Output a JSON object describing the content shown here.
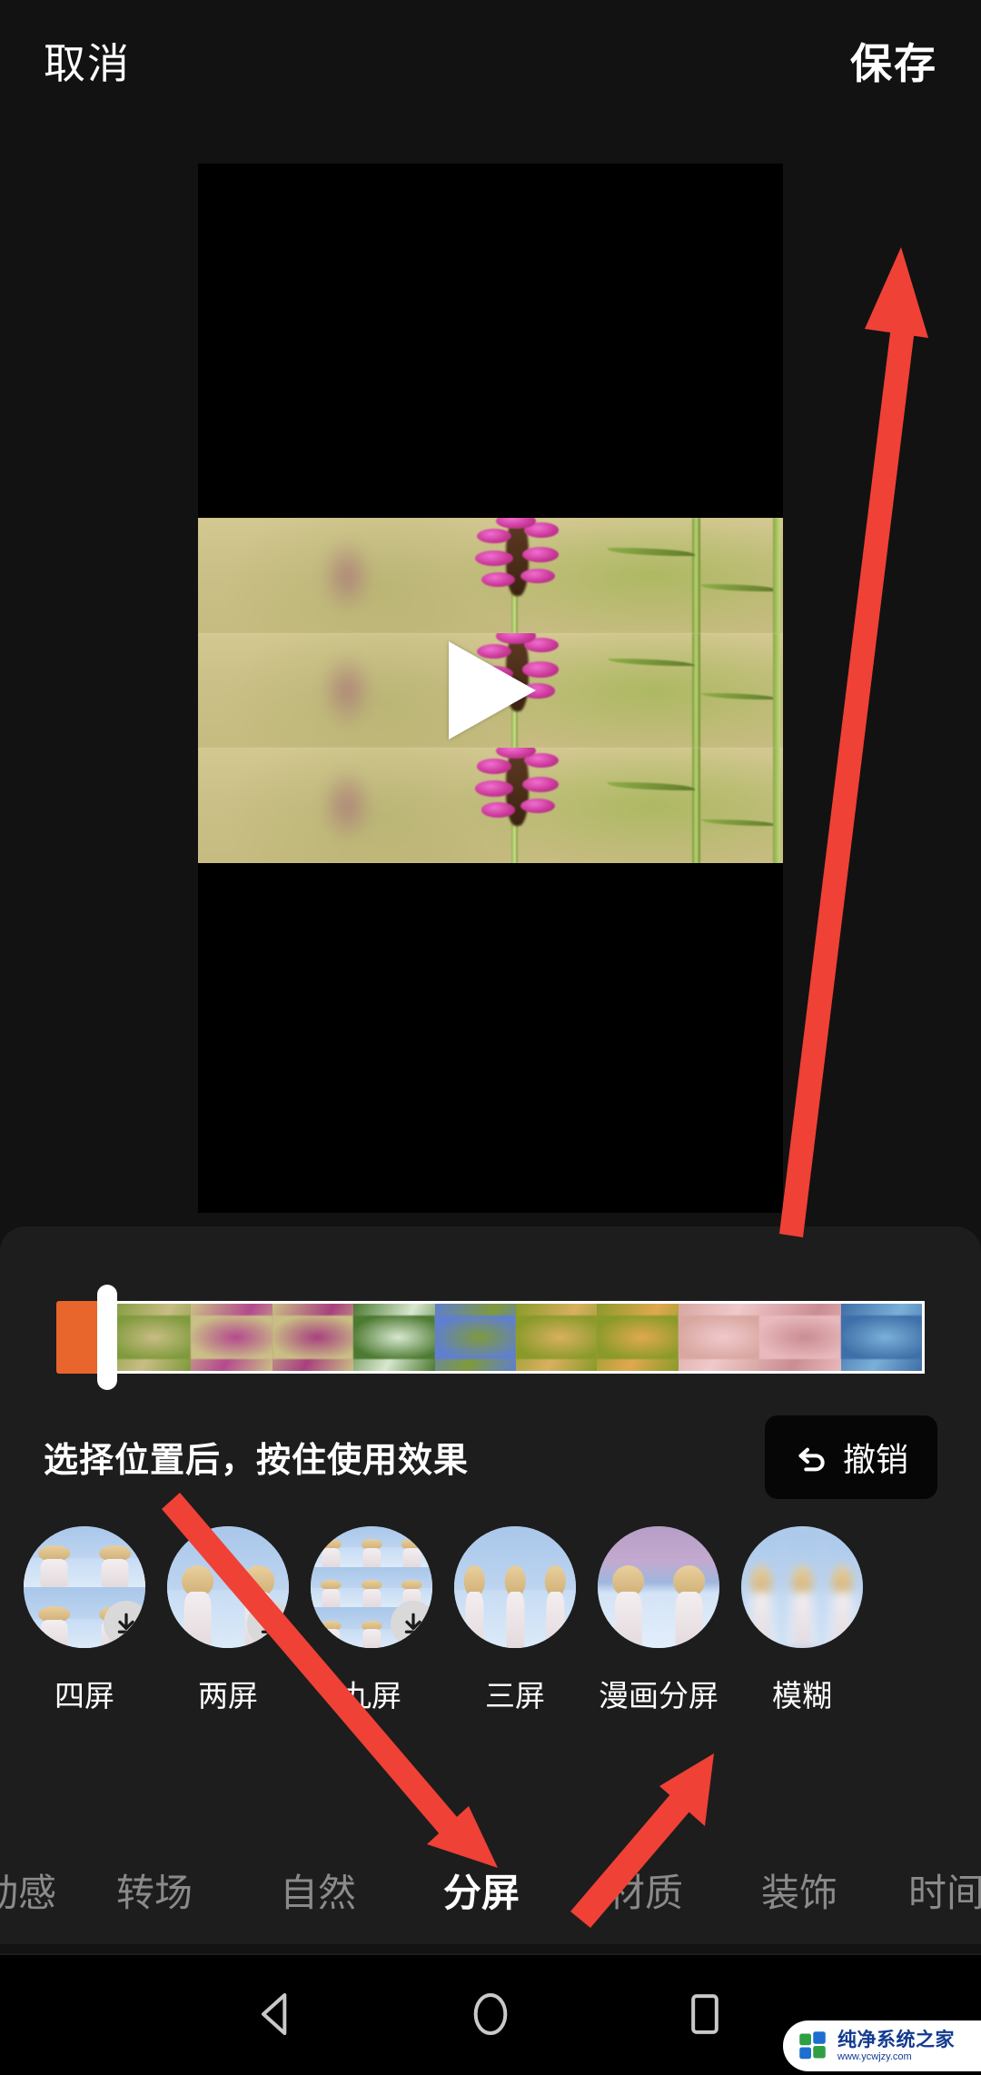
{
  "app": {
    "screen_name": "video-effects-editor",
    "accent_orange": "#e8652c",
    "annotation_red": "#ef4136",
    "panel_bg": "#1d1d1d",
    "screen_bg": "#121212"
  },
  "topbar": {
    "cancel_label": "取消",
    "save_label": "保存"
  },
  "preview": {
    "play_icon": "play-triangle-icon",
    "effect_applied": "三屏",
    "split_panes": 3
  },
  "timeline": {
    "clip_marker_color": "#e8652c",
    "playhead_position_pct": 4,
    "frames": [
      {
        "name": "frame-1",
        "colors": [
          "#7f9a3c",
          "#c8bd84"
        ]
      },
      {
        "name": "frame-2",
        "colors": [
          "#cabf86",
          "#b4498f"
        ]
      },
      {
        "name": "frame-3",
        "colors": [
          "#c9be84",
          "#a8407f"
        ]
      },
      {
        "name": "frame-4",
        "colors": [
          "#4d7a32",
          "#d8e8d0"
        ]
      },
      {
        "name": "frame-5",
        "colors": [
          "#5f7fd0",
          "#7f9a3c"
        ]
      },
      {
        "name": "frame-6",
        "colors": [
          "#8a9a2a",
          "#d8b060"
        ]
      },
      {
        "name": "frame-7",
        "colors": [
          "#8a9a2a",
          "#e0a94e"
        ]
      },
      {
        "name": "frame-8",
        "colors": [
          "#d8a7a0",
          "#f0c9cc"
        ]
      },
      {
        "name": "frame-9",
        "colors": [
          "#e8b9bd",
          "#c98d92"
        ]
      },
      {
        "name": "frame-10",
        "colors": [
          "#3f6fa8",
          "#7ab0d8"
        ]
      }
    ]
  },
  "hint": {
    "text": "选择位置后，按住使用效果"
  },
  "undo": {
    "label": "撤销",
    "icon": "undo-arrow-icon"
  },
  "effects": {
    "items": [
      {
        "name": "four-screen",
        "label": "四屏",
        "grid": "2x2",
        "needs_download": true,
        "style": "person"
      },
      {
        "name": "two-screen",
        "label": "两屏",
        "grid": "1x2",
        "needs_download": true,
        "style": "person"
      },
      {
        "name": "nine-screen",
        "label": "九屏",
        "grid": "3x3",
        "needs_download": true,
        "style": "person"
      },
      {
        "name": "three-screen",
        "label": "三屏",
        "grid": "1x3",
        "needs_download": false,
        "style": "person"
      },
      {
        "name": "comic-split",
        "label": "漫画分屏",
        "grid": "1x2",
        "needs_download": false,
        "style": "comic"
      },
      {
        "name": "blur",
        "label": "模糊",
        "grid": "1x3",
        "needs_download": false,
        "style": "blur"
      }
    ]
  },
  "tabs": {
    "items": [
      {
        "name": "tab-dynamic",
        "label": "动感",
        "active": false
      },
      {
        "name": "tab-transition",
        "label": "转场",
        "active": false
      },
      {
        "name": "tab-natural",
        "label": "自然",
        "active": false
      },
      {
        "name": "tab-split-screen",
        "label": "分屏",
        "active": true
      },
      {
        "name": "tab-material",
        "label": "材质",
        "active": false
      },
      {
        "name": "tab-decoration",
        "label": "装饰",
        "active": false
      },
      {
        "name": "tab-time",
        "label": "时间",
        "active": false
      }
    ]
  },
  "navbar": {
    "back": "back-triangle-icon",
    "home": "home-circle-icon",
    "recents": "recents-square-icon"
  },
  "watermark": {
    "title": "纯净系统之家",
    "url": "www.ycwjzy.com"
  },
  "annotations": {
    "arrow_save": "arrow-pointing-to-save-button",
    "arrow_split_tab": "arrow-pointing-to-split-screen-tab",
    "arrow_three_screen": "arrow-pointing-to-three-screen-effect"
  }
}
